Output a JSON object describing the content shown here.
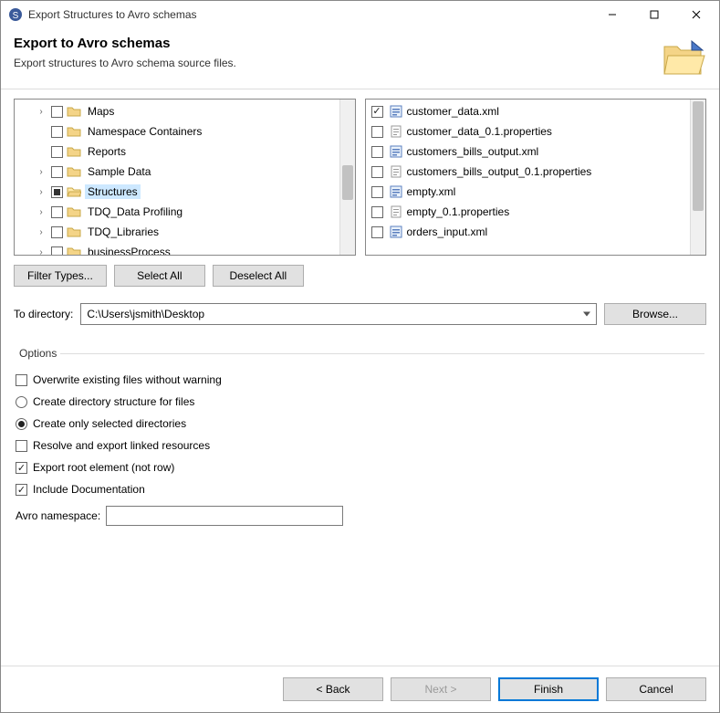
{
  "window": {
    "title": "Export Structures to Avro schemas"
  },
  "header": {
    "title": "Export to Avro schemas",
    "subtitle": "Export structures to Avro schema source files."
  },
  "tree": {
    "items": [
      {
        "label": "Maps",
        "expander": "›",
        "checked": false,
        "icon": "folder"
      },
      {
        "label": "Namespace Containers",
        "expander": "",
        "checked": false,
        "icon": "folder"
      },
      {
        "label": "Reports",
        "expander": "",
        "checked": false,
        "icon": "folder"
      },
      {
        "label": "Sample Data",
        "expander": "›",
        "checked": false,
        "icon": "folder"
      },
      {
        "label": "Structures",
        "expander": "›",
        "checked": "mixed",
        "icon": "folder-open",
        "selected": true
      },
      {
        "label": "TDQ_Data Profiling",
        "expander": "›",
        "checked": false,
        "icon": "folder"
      },
      {
        "label": "TDQ_Libraries",
        "expander": "›",
        "checked": false,
        "icon": "folder"
      },
      {
        "label": "businessProcess",
        "expander": "›",
        "checked": false,
        "icon": "folder"
      }
    ]
  },
  "files": {
    "items": [
      {
        "label": "customer_data.xml",
        "checked": true,
        "icon": "xml"
      },
      {
        "label": "customer_data_0.1.properties",
        "checked": false,
        "icon": "props"
      },
      {
        "label": "customers_bills_output.xml",
        "checked": false,
        "icon": "xml"
      },
      {
        "label": "customers_bills_output_0.1.properties",
        "checked": false,
        "icon": "props"
      },
      {
        "label": "empty.xml",
        "checked": false,
        "icon": "xml"
      },
      {
        "label": "empty_0.1.properties",
        "checked": false,
        "icon": "props"
      },
      {
        "label": "orders_input.xml",
        "checked": false,
        "icon": "xml"
      }
    ]
  },
  "buttons": {
    "filterTypes": "Filter Types...",
    "selectAll": "Select All",
    "deselectAll": "Deselect All"
  },
  "directory": {
    "label": "To directory:",
    "value": "C:\\Users\\jsmith\\Desktop",
    "browse": "Browse..."
  },
  "options": {
    "legend": "Options",
    "overwrite": {
      "label": "Overwrite existing files without warning",
      "checked": false
    },
    "createDirStructure": {
      "label": "Create directory structure for files",
      "checked": false
    },
    "createOnlySelected": {
      "label": "Create only selected directories",
      "checked": true
    },
    "resolveLinked": {
      "label": "Resolve and export linked resources",
      "checked": false
    },
    "exportRoot": {
      "label": "Export root element (not row)",
      "checked": true
    },
    "includeDoc": {
      "label": "Include Documentation",
      "checked": true
    },
    "namespaceLabel": "Avro namespace:",
    "namespaceValue": ""
  },
  "footer": {
    "back": "< Back",
    "next": "Next >",
    "finish": "Finish",
    "cancel": "Cancel"
  }
}
